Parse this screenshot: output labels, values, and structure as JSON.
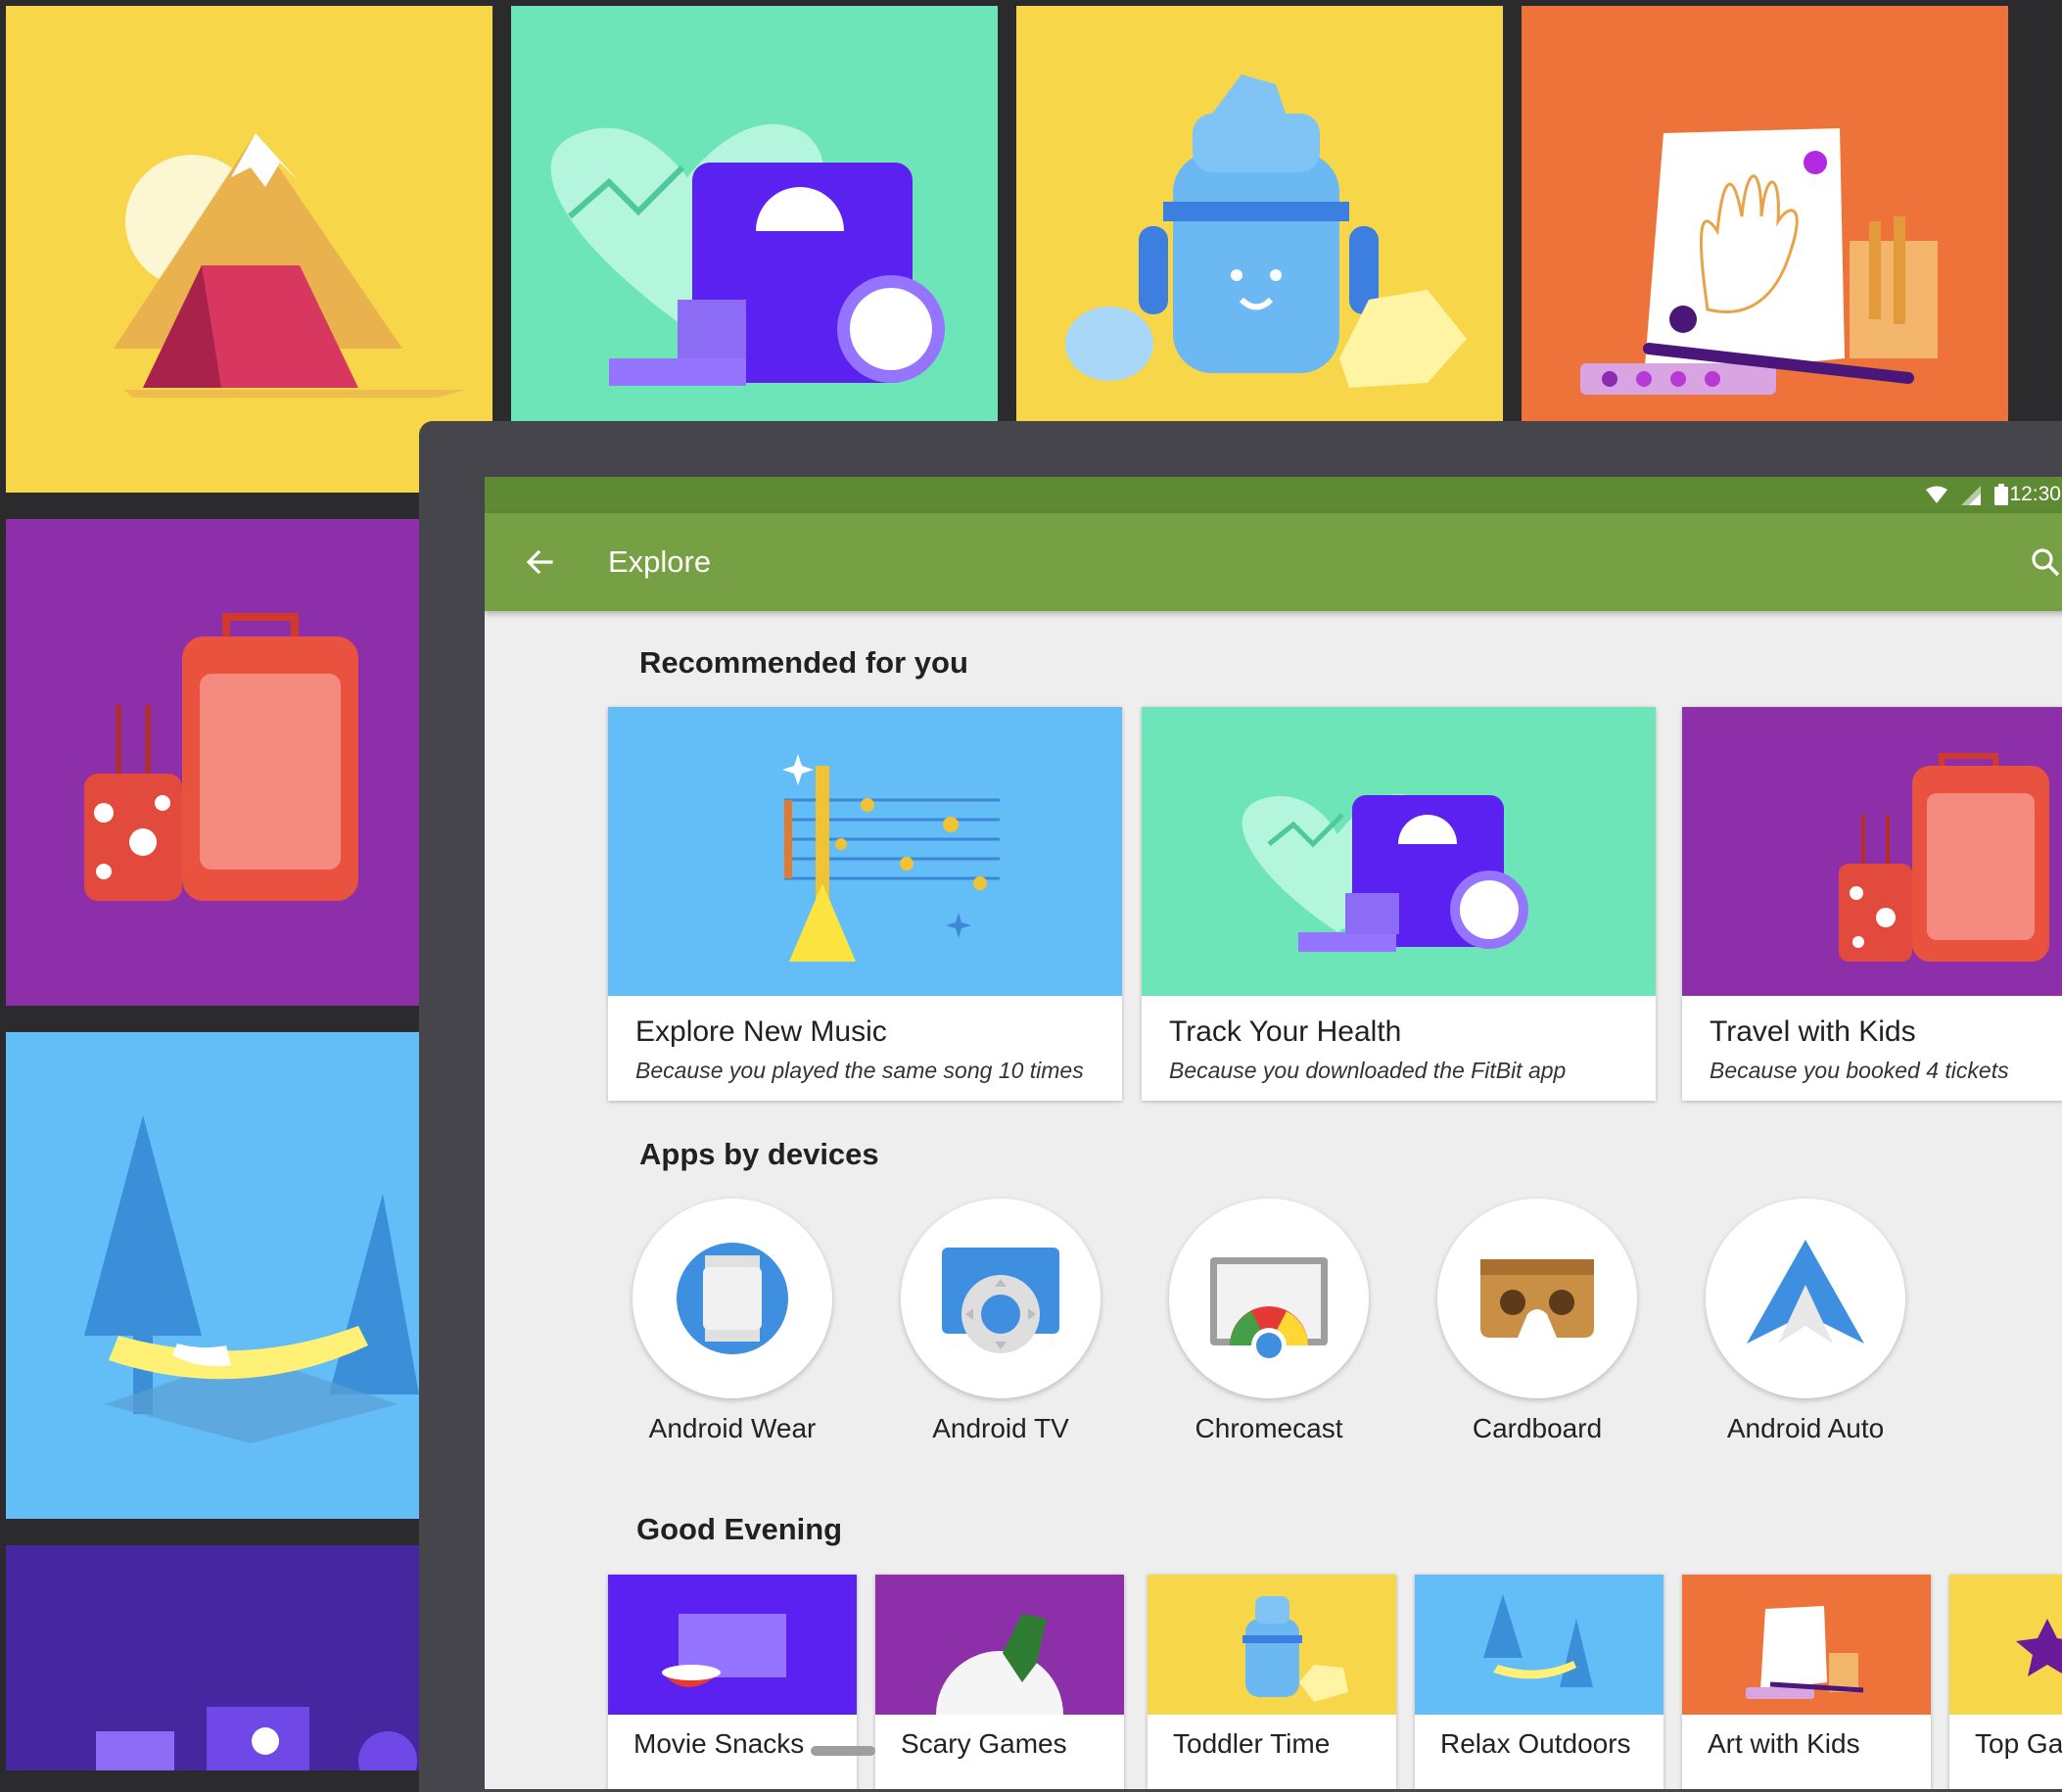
{
  "status_bar": {
    "time": "12:30"
  },
  "app_bar": {
    "title": "Explore"
  },
  "sections": {
    "recommended": "Recommended for you",
    "devices": "Apps by devices",
    "evening": "Good Evening"
  },
  "recommended_cards": [
    {
      "title": "Explore New Music",
      "subtitle": "Because you played the same song 10 times"
    },
    {
      "title": "Track Your Health",
      "subtitle": "Because you downloaded the FitBit app"
    },
    {
      "title": "Travel with Kids",
      "subtitle": "Because you booked 4 tickets"
    }
  ],
  "devices": [
    {
      "label": "Android Wear"
    },
    {
      "label": "Android TV"
    },
    {
      "label": "Chromecast"
    },
    {
      "label": "Cardboard"
    },
    {
      "label": "Android Auto"
    }
  ],
  "evening_cards": [
    {
      "label": "Movie Snacks"
    },
    {
      "label": "Scary Games"
    },
    {
      "label": "Toddler Time"
    },
    {
      "label": "Relax Outdoors"
    },
    {
      "label": "Art with Kids"
    },
    {
      "label": "Top Ga"
    }
  ],
  "colors": {
    "app_bar": "#76a043",
    "status_bar": "#5e8a33",
    "yellow": "#f8d64a",
    "mint": "#6de5b8",
    "orange": "#ee733a",
    "purple": "#8c2fa8",
    "sky": "#63bdf6",
    "indigo": "#4527a0"
  }
}
